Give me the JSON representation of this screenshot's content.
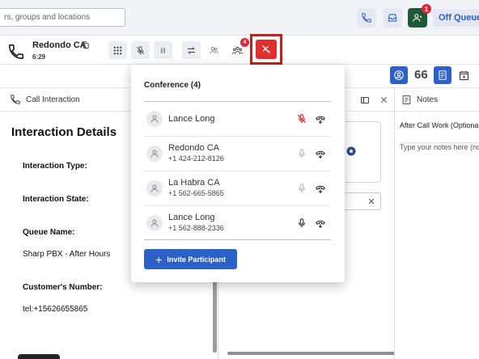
{
  "topbar": {
    "search_placeholder": "rs, groups and locations",
    "notification_count": "1",
    "status_label": "Off Queue"
  },
  "call": {
    "title": "Redondo CA",
    "duration": "6:29",
    "participant_badge": "4"
  },
  "toolbar_right": {
    "count": "66"
  },
  "left_panel": {
    "header": "Call Interaction",
    "section_title": "Interaction Details",
    "fields": [
      {
        "label": "Interaction Type:",
        "value": ""
      },
      {
        "label": "Interaction State:",
        "value": ""
      },
      {
        "label": "Queue Name:",
        "value": "Sharp PBX - After Hours"
      },
      {
        "label": "Customer's Number:",
        "value": "tel:+15626655865"
      }
    ]
  },
  "notes_panel": {
    "header": "Notes",
    "subheader": "After Call Work (Optional",
    "placeholder": "Type your notes here (no"
  },
  "conference": {
    "title": "Conference (4)",
    "participants": [
      {
        "name": "Lance Long",
        "phone": "",
        "muted": true
      },
      {
        "name": "Redondo CA",
        "phone": "+1 424-212-8126",
        "muted": false
      },
      {
        "name": "La Habra CA",
        "phone": "+1 562-665-5865",
        "muted": false
      },
      {
        "name": "Lance Long",
        "phone": "+1 562-888-2336",
        "muted": false
      }
    ],
    "invite_label": "Invite Participant"
  },
  "colors": {
    "accent": "#2c62c8",
    "danger": "#e02f2f",
    "highlight_border": "#c0221e"
  }
}
